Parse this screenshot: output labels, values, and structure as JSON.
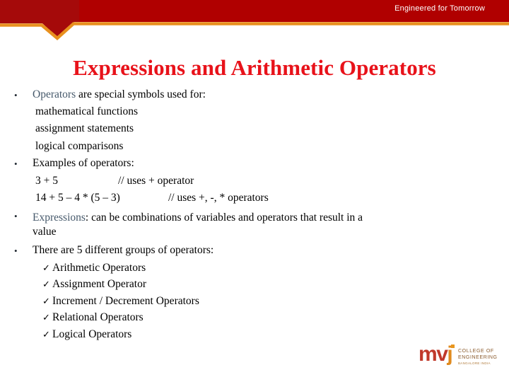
{
  "header": {
    "tagline": "Engineered for Tomorrow",
    "band_color": "#b00000",
    "accent_color": "#e8901e"
  },
  "slide": {
    "title": "Expressions and Arithmetic Operators",
    "title_color": "#e8121a",
    "accent_text_color": "#46596b"
  },
  "body": {
    "bullet_glyph": "•",
    "check_glyph": "✓",
    "b1": {
      "accent": "Operators",
      "rest": " are special symbols used for:",
      "sub": [
        "mathematical functions",
        "assignment statements",
        "logical comparisons"
      ]
    },
    "b2": {
      "label": "Examples of operators:",
      "lines": [
        {
          "expr": "3 + 5",
          "comment": "// uses + operator"
        },
        {
          "expr": "14 + 5 – 4 * (5 – 3)",
          "comment": "// uses +, -, * operators"
        }
      ]
    },
    "b3": {
      "accent": "Expressions",
      "rest": ": can be combinations of variables and operators that result in a",
      "cont": "value"
    },
    "b4": {
      "label": "There are 5 different groups of operators:",
      "items": [
        "Arithmetic Operators",
        "Assignment Operator",
        "Increment / Decrement Operators",
        "Relational Operators",
        "Logical Operators"
      ]
    }
  },
  "logo": {
    "mark_m": "m",
    "mark_v": "v",
    "mark_j": "j",
    "line1": "COLLEGE OF",
    "line2": "ENGINEERING",
    "line3": "BANGALORE INDIA",
    "color_primary": "#c0392b",
    "color_secondary": "#e08a1e"
  }
}
